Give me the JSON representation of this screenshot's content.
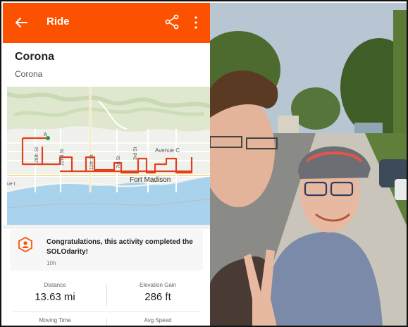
{
  "app_bar": {
    "title": "Ride",
    "accent": "#fc5200",
    "icons": [
      "back-arrow-icon",
      "share-icon",
      "more-vertical-icon"
    ]
  },
  "activity": {
    "title": "Corona",
    "subtitle": "Corona"
  },
  "map": {
    "labels": {
      "street_26th": "26th St",
      "street_22nd": "22nd St",
      "street_11th": "11th St",
      "street_7th": "7th St",
      "street_3rd": "3rd St",
      "avenue_c": "Avenue C",
      "city": "Fort Madison",
      "hwy_label": "ue I",
      "marker_a": "A"
    },
    "route_color": "#e0401c"
  },
  "achievement": {
    "message": "Congratulations, this activity completed the SOLOdarity!",
    "time": "10h",
    "icon": "badge-icon"
  },
  "stats": {
    "distance_label": "Distance",
    "distance_value": "13.63 mi",
    "elevation_label": "Elevation Gain",
    "elevation_value": "286 ft",
    "moving_time_label": "Moving Time",
    "avg_speed_label": "Avg Speed"
  }
}
